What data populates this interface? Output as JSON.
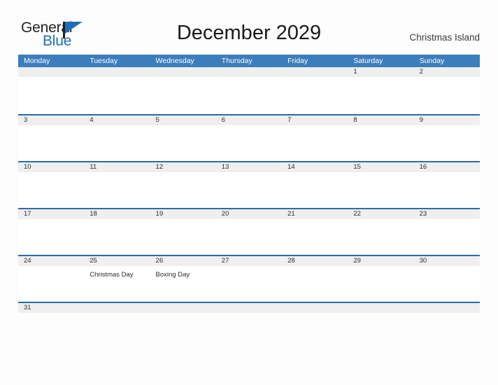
{
  "brand": {
    "name_part1": "General",
    "name_part2": "Blue",
    "flag_icon": "flag-triangle-icon",
    "accent_color": "#1f6fb8"
  },
  "header": {
    "title": "December 2029",
    "location": "Christmas Island"
  },
  "colors": {
    "header_blue": "#3b7ebc",
    "row_divider_blue": "#2a6ca8",
    "date_band_gray": "#efefef",
    "page_background": "#fdfdfd",
    "text_dark": "#2b2b2b"
  },
  "calendar": {
    "month": "December",
    "year": "2029",
    "weekdays": [
      "Monday",
      "Tuesday",
      "Wednesday",
      "Thursday",
      "Friday",
      "Saturday",
      "Sunday"
    ],
    "weeks": [
      {
        "days": [
          {
            "number": "",
            "event": ""
          },
          {
            "number": "",
            "event": ""
          },
          {
            "number": "",
            "event": ""
          },
          {
            "number": "",
            "event": ""
          },
          {
            "number": "",
            "event": ""
          },
          {
            "number": "1",
            "event": ""
          },
          {
            "number": "2",
            "event": ""
          }
        ]
      },
      {
        "days": [
          {
            "number": "3",
            "event": ""
          },
          {
            "number": "4",
            "event": ""
          },
          {
            "number": "5",
            "event": ""
          },
          {
            "number": "6",
            "event": ""
          },
          {
            "number": "7",
            "event": ""
          },
          {
            "number": "8",
            "event": ""
          },
          {
            "number": "9",
            "event": ""
          }
        ]
      },
      {
        "days": [
          {
            "number": "10",
            "event": ""
          },
          {
            "number": "11",
            "event": ""
          },
          {
            "number": "12",
            "event": ""
          },
          {
            "number": "13",
            "event": ""
          },
          {
            "number": "14",
            "event": ""
          },
          {
            "number": "15",
            "event": ""
          },
          {
            "number": "16",
            "event": ""
          }
        ]
      },
      {
        "days": [
          {
            "number": "17",
            "event": ""
          },
          {
            "number": "18",
            "event": ""
          },
          {
            "number": "19",
            "event": ""
          },
          {
            "number": "20",
            "event": ""
          },
          {
            "number": "21",
            "event": ""
          },
          {
            "number": "22",
            "event": ""
          },
          {
            "number": "23",
            "event": ""
          }
        ]
      },
      {
        "days": [
          {
            "number": "24",
            "event": ""
          },
          {
            "number": "25",
            "event": "Christmas Day"
          },
          {
            "number": "26",
            "event": "Boxing Day"
          },
          {
            "number": "27",
            "event": ""
          },
          {
            "number": "28",
            "event": ""
          },
          {
            "number": "29",
            "event": ""
          },
          {
            "number": "30",
            "event": ""
          }
        ]
      },
      {
        "days": [
          {
            "number": "31",
            "event": ""
          },
          {
            "number": "",
            "event": ""
          },
          {
            "number": "",
            "event": ""
          },
          {
            "number": "",
            "event": ""
          },
          {
            "number": "",
            "event": ""
          },
          {
            "number": "",
            "event": ""
          },
          {
            "number": "",
            "event": ""
          }
        ]
      }
    ]
  }
}
